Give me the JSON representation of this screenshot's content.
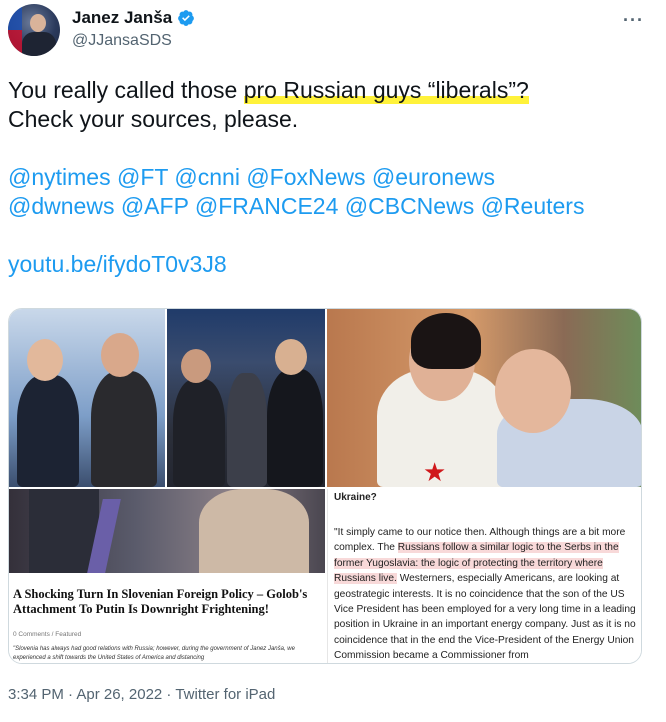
{
  "author": {
    "display_name": "Janez Janša",
    "handle": "@JJansaSDS"
  },
  "tweet": {
    "line1_pre": "You really called those ",
    "line1_highlight": "pro Russian guys “liberals”?",
    "line2": "Check your sources, please.",
    "mentions_line1": "@nytimes @FT @cnni @FoxNews @euronews",
    "mentions_line2": "@dwnews @AFP @FRANCE24 @CBCNews @Reuters",
    "link": "youtu.be/ifydoT0v3J8"
  },
  "media": {
    "left_article": {
      "title": "A Shocking Turn In Slovenian Foreign Policy – Golob's Attachment To Putin Is Downright Frightening!",
      "meta": "0 Comments / Featured",
      "excerpt": "\"Slovenia has always had good relations with Russia; however, during the government of Janez Janša, we experienced a shift towards the United States of America and distancing"
    },
    "right_article": {
      "heading": "Ukraine?",
      "p1": "\"It simply came to our notice then. Although things are a bit more complex. The ",
      "p1_hl1": "Russians follow a similar logic to the Serbs in the",
      "p1_hl2": "former Yugoslavia: the logic of protecting the territory where",
      "p1_hl3": "Russians live.",
      "p1_rest": " Westerners, especially Americans, are looking at geostrategic interests. It is no coincidence that the son of the US Vice President has been employed for a very long time in a leading position in Ukraine in an important energy company. Just as it is no coincidence that in the end the Vice-President of the Energy Union Commission became a Commissioner from"
    }
  },
  "footer": {
    "meta": "3:34 PM · Apr 26, 2022 · Twitter for iPad"
  },
  "colors": {
    "link": "#1d9bf0",
    "highlight": "#fff23a",
    "verified": "#1d9bf0",
    "secondary_text": "#536471"
  }
}
